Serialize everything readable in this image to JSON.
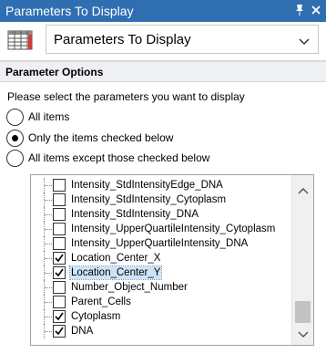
{
  "window": {
    "title": "Parameters To Display",
    "pin_icon": "pin-icon",
    "close_icon": "close-icon"
  },
  "toolbar": {
    "grid_icon": "table-grid-icon",
    "dropdown_value": "Parameters To Display"
  },
  "section": {
    "header": "Parameter Options",
    "prompt": "Please select the parameters you want to display"
  },
  "options": {
    "all": "All items",
    "only": "Only the items checked below",
    "except": "All items except those checked below",
    "selected": "only"
  },
  "list": {
    "items": [
      {
        "label": "Intensity_StdIntensityEdge_DNA",
        "checked": false
      },
      {
        "label": "Intensity_StdIntensity_Cytoplasm",
        "checked": false
      },
      {
        "label": "Intensity_StdIntensity_DNA",
        "checked": false
      },
      {
        "label": "Intensity_UpperQuartileIntensity_Cytoplasm",
        "checked": false
      },
      {
        "label": "Intensity_UpperQuartileIntensity_DNA",
        "checked": false
      },
      {
        "label": "Location_Center_X",
        "checked": true
      },
      {
        "label": "Location_Center_Y",
        "checked": true,
        "selected": true
      },
      {
        "label": "Number_Object_Number",
        "checked": false
      },
      {
        "label": "Parent_Cells",
        "checked": false
      },
      {
        "label": "Cytoplasm",
        "checked": true
      },
      {
        "label": "DNA",
        "checked": true
      }
    ]
  },
  "colors": {
    "titlebar": "#2f6fb1",
    "selection": "#cce4f7",
    "section_header": "#eef0f3"
  }
}
